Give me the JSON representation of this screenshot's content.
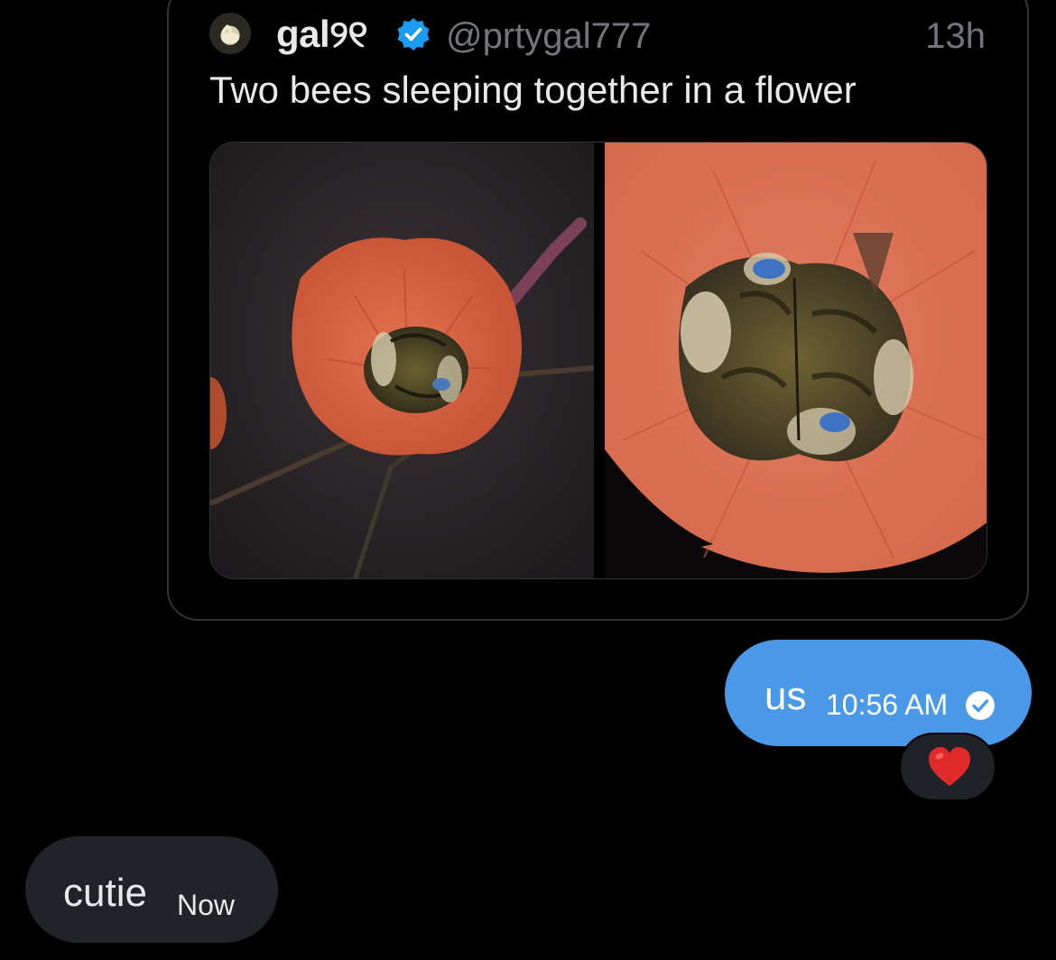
{
  "quoted_post": {
    "author": {
      "display_name": "gal୨୧",
      "handle": "@prtygal777",
      "verified": true
    },
    "time_ago": "13h",
    "text": "Two bees sleeping together in a flower",
    "media": {
      "count": 2,
      "subjects": [
        "two-bees-in-orange-flower-wide",
        "two-bees-in-orange-flower-closeup"
      ]
    }
  },
  "messages": [
    {
      "direction": "outgoing",
      "text": "us",
      "time": "10:56 AM",
      "status": "read",
      "reaction": "heart"
    },
    {
      "direction": "incoming",
      "text": "cutie",
      "time": "Now"
    }
  ],
  "colors": {
    "background": "#000000",
    "outgoing_bubble": "#4a99e9",
    "incoming_bubble": "#202327",
    "verified_blue": "#1d9bf0",
    "muted_text": "#71767b",
    "heart": "#e02a2a"
  }
}
